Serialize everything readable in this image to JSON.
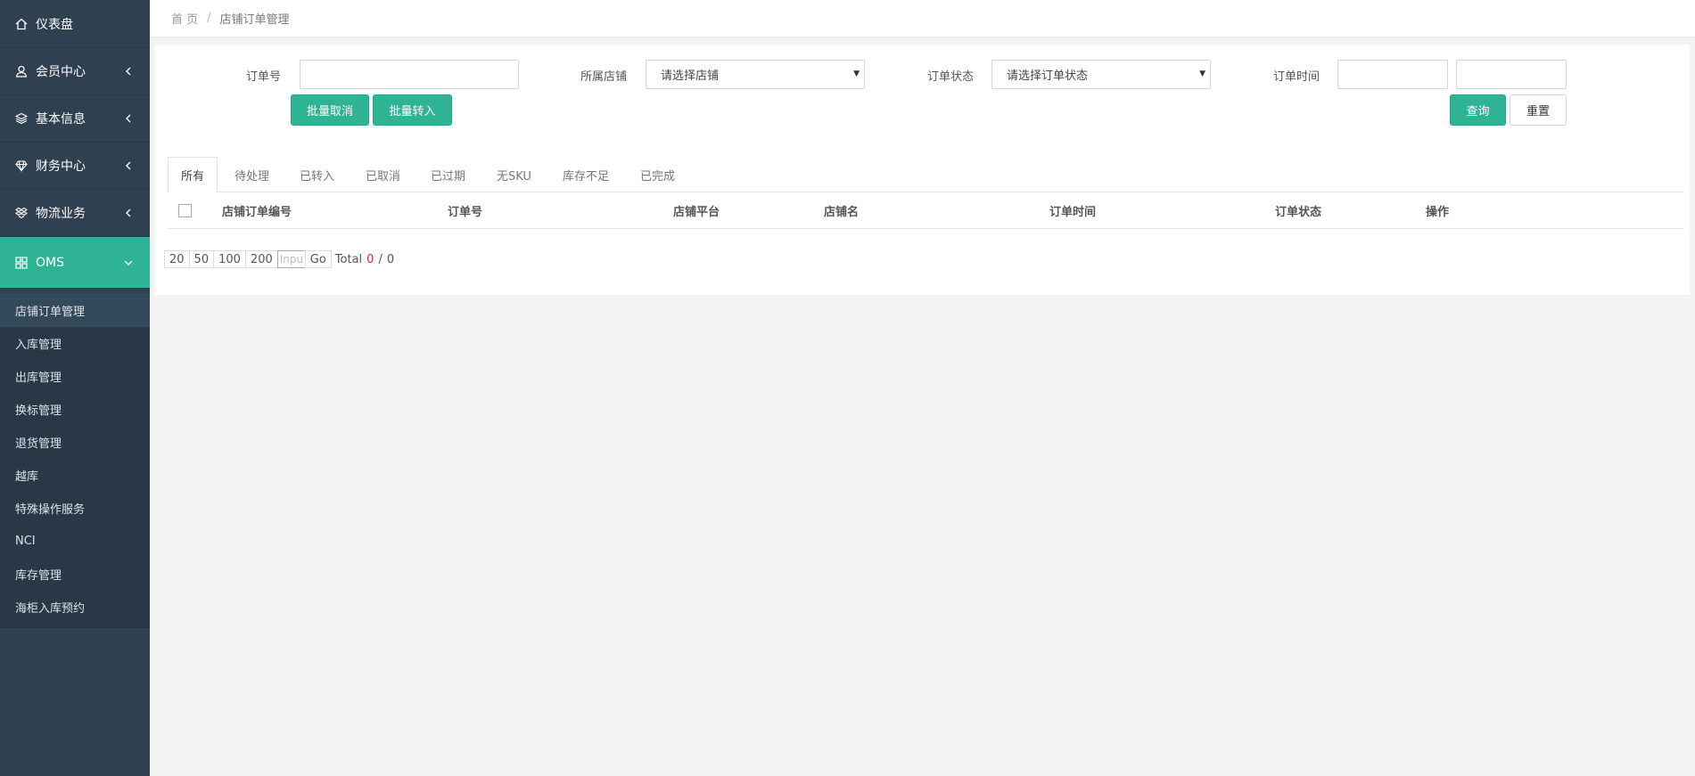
{
  "sidebar": {
    "items": [
      {
        "label": "仪表盘",
        "icon": "home-icon"
      },
      {
        "label": "会员中心",
        "icon": "user-icon"
      },
      {
        "label": "基本信息",
        "icon": "layers-icon"
      },
      {
        "label": "财务中心",
        "icon": "diamond-icon"
      },
      {
        "label": "物流业务",
        "icon": "dropbox-icon"
      },
      {
        "label": "OMS",
        "icon": "grid-icon"
      }
    ],
    "sub_items": [
      "店铺订单管理",
      "入库管理",
      "出库管理",
      "换标管理",
      "退货管理",
      "越库",
      "特殊操作服务",
      "NCI",
      "库存管理",
      "海柜入库预约"
    ]
  },
  "breadcrumb": {
    "home": "首 页",
    "separator": "/",
    "current": "店铺订单管理"
  },
  "filters": {
    "order_no_label": "订单号",
    "store_label": "所属店铺",
    "store_placeholder": "请选择店铺",
    "status_label": "订单状态",
    "status_placeholder": "请选择订单状态",
    "time_label": "订单时间"
  },
  "buttons": {
    "batch_cancel": "批量取消",
    "batch_transfer": "批量转入",
    "query": "查询",
    "reset": "重置"
  },
  "tabs": [
    "所有",
    "待处理",
    "已转入",
    "已取消",
    "已过期",
    "无SKU",
    "库存不足",
    "已完成"
  ],
  "table": {
    "columns": [
      "店铺订单编号",
      "订单号",
      "店铺平台",
      "店铺名",
      "订单时间",
      "订单状态",
      "操作"
    ]
  },
  "pagination": {
    "sizes": [
      "20",
      "50",
      "100",
      "200"
    ],
    "input_placeholder": "Inpu",
    "go": "Go",
    "total_label": "Total",
    "current": "0",
    "slash": "/",
    "pages": "0"
  },
  "colors": {
    "sidebar_bg": "#2f4050",
    "accent": "#2eb394",
    "content_bg": "#f3f3f4"
  }
}
